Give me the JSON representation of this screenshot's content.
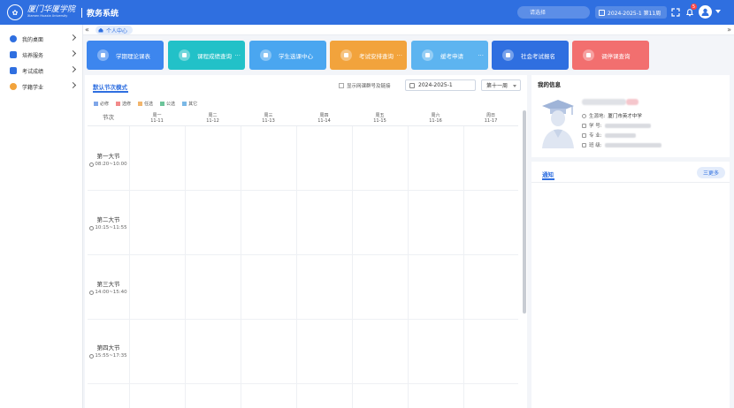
{
  "header": {
    "university_name": "厦门华厦学院",
    "university_en": "Xiamen Huaxia University",
    "system_title": "教务系统",
    "search_placeholder": "请选择",
    "term_label": "2024-2025-1 第11周",
    "notification_count": "5"
  },
  "sidebar": {
    "items": [
      {
        "label": "我的桌面",
        "color": "#2f6fe0"
      },
      {
        "label": "培养服务",
        "color": "#2f6fe0"
      },
      {
        "label": "考试成绩",
        "color": "#2f6fe0"
      },
      {
        "label": "学籍学业",
        "color": "#f2a33c"
      }
    ]
  },
  "tabbar": {
    "active_tab": "个人中心"
  },
  "quick_buttons": [
    {
      "label": "学期理论课表",
      "color": "#3d86ee"
    },
    {
      "label": "课程成绩查询",
      "color": "#22c1c8"
    },
    {
      "label": "学生选课中心",
      "color": "#4aa6f0"
    },
    {
      "label": "考试安排查询",
      "color": "#f2a33c"
    },
    {
      "label": "缓考申请",
      "color": "#5db4f0"
    },
    {
      "label": "社会考试报名",
      "color": "#2f6fe0"
    },
    {
      "label": "调停课查询",
      "color": "#f26f6f"
    }
  ],
  "schedule": {
    "mode_title": "默认节次模式",
    "show_checkbox_label": "显示网课群号及链接",
    "term_value": "2024-2025-1",
    "week_value": "第十一周",
    "legend": [
      {
        "label": "必修",
        "color": "#7fa6e8"
      },
      {
        "label": "选修",
        "color": "#f28a8a"
      },
      {
        "label": "任选",
        "color": "#f2b56c"
      },
      {
        "label": "公选",
        "color": "#6cc49a"
      },
      {
        "label": "其它",
        "color": "#7ab8e6"
      }
    ],
    "section_header": "节次",
    "days": [
      {
        "name": "周一",
        "date": "11-11"
      },
      {
        "name": "周二",
        "date": "11-12"
      },
      {
        "name": "周三",
        "date": "11-13"
      },
      {
        "name": "周四",
        "date": "11-14"
      },
      {
        "name": "周五",
        "date": "11-15"
      },
      {
        "name": "周六",
        "date": "11-16"
      },
      {
        "name": "周日",
        "date": "11-17"
      }
    ],
    "periods": [
      {
        "name": "第一大节",
        "time": "08:20~10:00"
      },
      {
        "name": "第二大节",
        "time": "10:15~11:55"
      },
      {
        "name": "第三大节",
        "time": "14:00~15:40"
      },
      {
        "name": "第四大节",
        "time": "15:55~17:35"
      }
    ]
  },
  "info": {
    "title": "我的信息",
    "rows": [
      {
        "label": "生源地:",
        "value": "厦门市英才中学"
      },
      {
        "label": "学  号:",
        "value": ""
      },
      {
        "label": "专  业:",
        "value": ""
      },
      {
        "label": "班  级:",
        "value": ""
      }
    ]
  },
  "notice": {
    "tab_label": "通知",
    "more_label": "三更多"
  }
}
